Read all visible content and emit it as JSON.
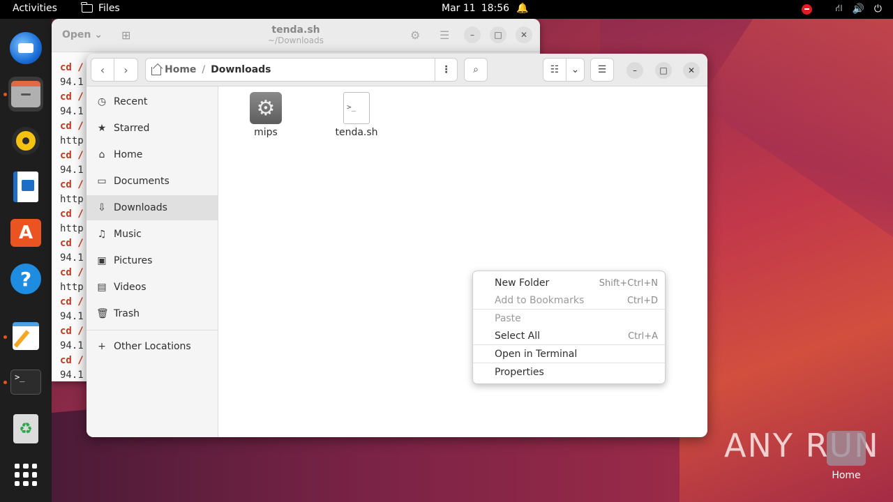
{
  "topbar": {
    "activities": "Activities",
    "app_name": "Files",
    "date": "Mar 11",
    "time": "18:56"
  },
  "dock": {
    "items": [
      "thunderbird-icon",
      "files-icon",
      "rhythmbox-icon",
      "writer-icon",
      "app-center-icon",
      "help-icon",
      "text-editor-icon",
      "terminal-icon",
      "trash-icon",
      "show-apps-icon"
    ]
  },
  "editor_window": {
    "open_label": "Open",
    "title": "tenda.sh",
    "subtitle": "~/Downloads",
    "lines": [
      {
        "text": "cd /",
        "kw": true
      },
      {
        "text": "94.1",
        "kw": false
      },
      {
        "text": "cd /",
        "kw": true
      },
      {
        "text": "94.1",
        "kw": false
      },
      {
        "text": "cd /",
        "kw": true
      },
      {
        "text": "http",
        "kw": false
      },
      {
        "text": "cd /",
        "kw": true
      },
      {
        "text": "94.1",
        "kw": false
      },
      {
        "text": "cd /",
        "kw": true
      },
      {
        "text": "http",
        "kw": false
      },
      {
        "text": "cd /",
        "kw": true
      },
      {
        "text": "http",
        "kw": false
      },
      {
        "text": "cd /",
        "kw": true
      },
      {
        "text": "94.1",
        "kw": false
      },
      {
        "text": "cd /",
        "kw": true
      },
      {
        "text": "http",
        "kw": false
      },
      {
        "text": "cd /",
        "kw": true
      },
      {
        "text": "94.1",
        "kw": false
      },
      {
        "text": "cd /",
        "kw": true
      },
      {
        "text": "94.1",
        "kw": false
      },
      {
        "text": "cd /",
        "kw": true
      },
      {
        "text": "94.1",
        "kw": false
      }
    ]
  },
  "files_window": {
    "path": {
      "home": "Home",
      "current": "Downloads",
      "separator": "/"
    },
    "sidebar": [
      {
        "label": "Recent",
        "icon": "clock-icon",
        "glyph": "◷"
      },
      {
        "label": "Starred",
        "icon": "star-icon",
        "glyph": "★"
      },
      {
        "label": "Home",
        "icon": "home-icon",
        "glyph": "⌂"
      },
      {
        "label": "Documents",
        "icon": "document-icon",
        "glyph": "▭"
      },
      {
        "label": "Downloads",
        "icon": "download-icon",
        "glyph": "⇩"
      },
      {
        "label": "Music",
        "icon": "music-icon",
        "glyph": "♫"
      },
      {
        "label": "Pictures",
        "icon": "picture-icon",
        "glyph": "▣"
      },
      {
        "label": "Videos",
        "icon": "video-icon",
        "glyph": "▤"
      },
      {
        "label": "Trash",
        "icon": "trash-icon",
        "glyph": "🗑"
      },
      {
        "label": "Other Locations",
        "icon": "plus-icon",
        "glyph": "+"
      }
    ],
    "files": [
      {
        "name": "mips",
        "icon": "executable-gear-icon"
      },
      {
        "name": "tenda.sh",
        "icon": "shell-script-icon"
      }
    ]
  },
  "context_menu": {
    "items": [
      {
        "label": "New Folder",
        "accel": "Shift+Ctrl+N",
        "disabled": false
      },
      {
        "label": "Add to Bookmarks",
        "accel": "Ctrl+D",
        "disabled": true
      },
      {
        "label": "Paste",
        "accel": "",
        "disabled": true
      },
      {
        "label": "Select All",
        "accel": "Ctrl+A",
        "disabled": false
      },
      {
        "label": "Open in Terminal",
        "accel": "",
        "disabled": false
      },
      {
        "label": "Properties",
        "accel": "",
        "disabled": false
      }
    ]
  },
  "desktop": {
    "home_label": "Home",
    "watermark": "ANY RUN"
  },
  "colors": {
    "accent": "#e95420",
    "keyword": "#c4351b"
  }
}
